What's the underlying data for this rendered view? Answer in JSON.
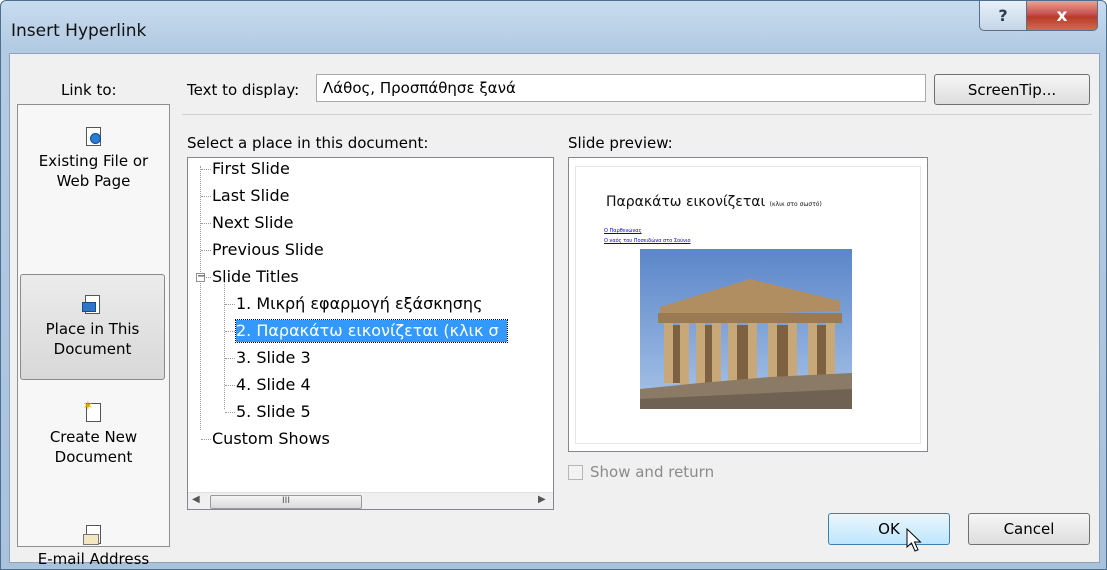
{
  "window": {
    "title": "Insert Hyperlink",
    "help_glyph": "?",
    "close_glyph": "x"
  },
  "link_to": {
    "label": "Link to:",
    "items": [
      {
        "line1": "Existing File or",
        "line2": "Web Page",
        "icon": "existing-file-icon"
      },
      {
        "line1": "Place in This",
        "line2": "Document",
        "icon": "place-in-document-icon",
        "selected": true
      },
      {
        "line1": "Create New",
        "line2": "Document",
        "icon": "new-document-icon"
      },
      {
        "line1": "E-mail Address",
        "line2": "",
        "icon": "email-icon"
      }
    ]
  },
  "text_to_display": {
    "label": "Text to display:",
    "value": "Λάθος, Προσπάθησε ξανά"
  },
  "screentip_label": "ScreenTip...",
  "place_label": "Select a place in this document:",
  "tree": {
    "items": [
      {
        "text": "First Slide",
        "level": 0
      },
      {
        "text": "Last Slide",
        "level": 0
      },
      {
        "text": "Next Slide",
        "level": 0
      },
      {
        "text": "Previous Slide",
        "level": 0
      },
      {
        "text": "Slide Titles",
        "level": 0,
        "expanded": true
      },
      {
        "text": "1. Μικρή εφαρμογή εξάσκησης",
        "level": 1
      },
      {
        "text": "2. Παρακάτω εικονίζεται (κλικ σ",
        "level": 1,
        "selected": true
      },
      {
        "text": "3. Slide 3",
        "level": 1
      },
      {
        "text": "4. Slide 4",
        "level": 1
      },
      {
        "text": "5. Slide 5",
        "level": 1
      },
      {
        "text": "Custom Shows",
        "level": 0
      }
    ],
    "scroll_thumb_glyph": "III"
  },
  "preview": {
    "label": "Slide preview:",
    "slide_title": "Παρακάτω εικονίζεται",
    "slide_title_small": "(κλικ στο σωστό)",
    "bullets": [
      "Ο Παρθενώνας",
      "Ο ναός του Ποσειδώνα στο Σούνιο"
    ]
  },
  "show_and_return": {
    "label": "Show and return",
    "checked": false
  },
  "buttons": {
    "ok": "OK",
    "cancel": "Cancel"
  }
}
